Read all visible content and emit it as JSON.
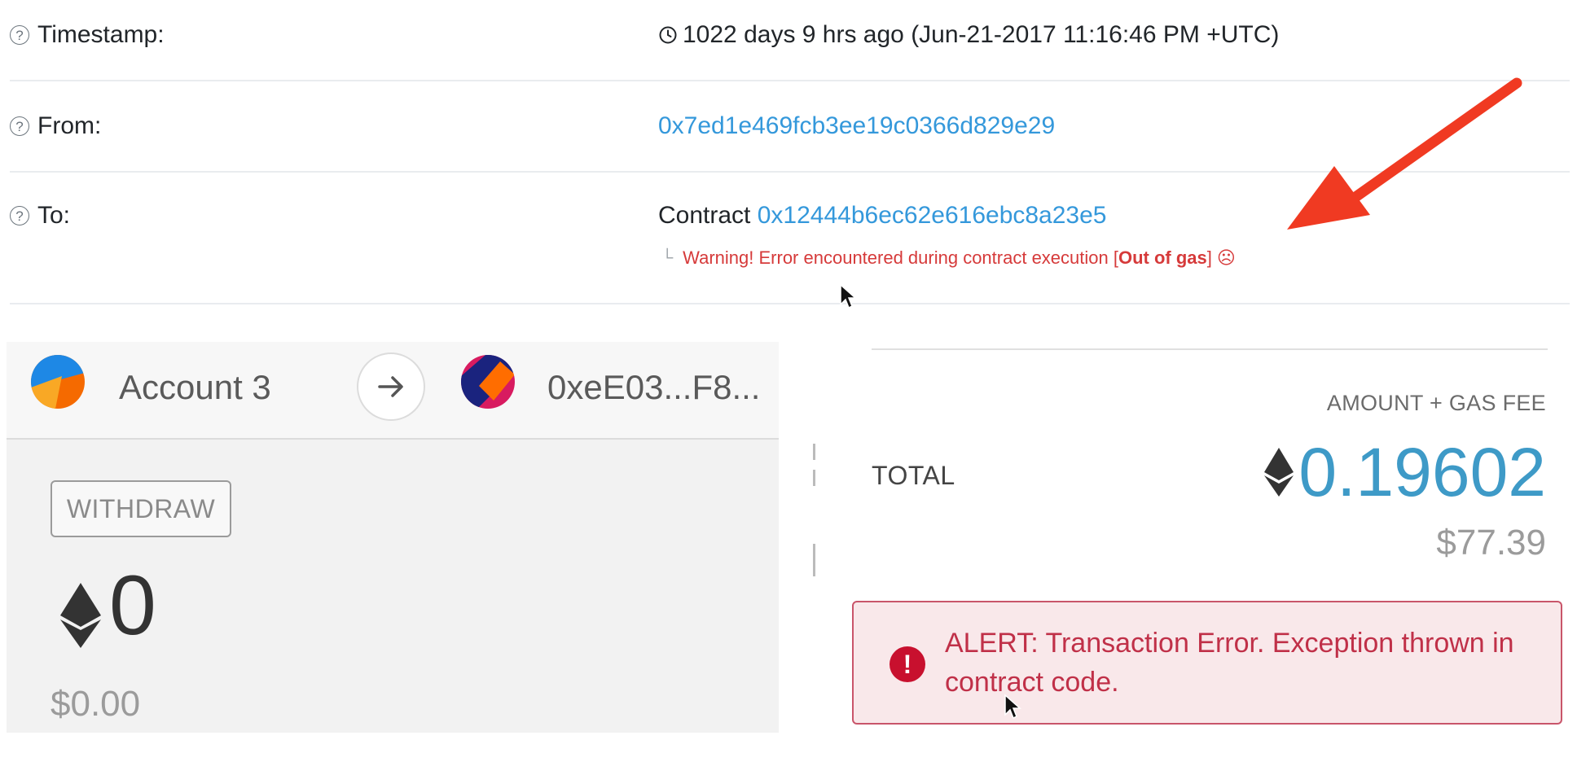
{
  "transaction": {
    "timestamp_label": "Timestamp:",
    "timestamp_value": "1022 days 9 hrs ago (Jun-21-2017 11:16:46 PM +UTC)",
    "from_label": "From:",
    "from_value": "0x7ed1e469fcb3ee19c0366d829e29",
    "to_label": "To:",
    "to_prefix": "Contract",
    "to_value": "0x12444b6ec62e616ebc8a23e5",
    "warning_prefix": "Warning! Error encountered during contract execution [",
    "warning_bold": "Out of gas",
    "warning_suffix": "]",
    "help_symbol": "?",
    "sad_symbol": "☹",
    "corner_symbol": "└"
  },
  "metamask": {
    "account_name": "Account 3",
    "recipient_short": "0xeE03...F8...",
    "withdraw_label": "WITHDRAW",
    "balance": "0",
    "balance_fiat": "$0.00",
    "amount_gas_label": "AMOUNT + GAS FEE",
    "total_label": "TOTAL",
    "total_eth": "0.19602",
    "total_fiat": "$77.39",
    "alert_symbol": "!",
    "alert_text": "ALERT: Transaction Error. Exception thrown in contract code."
  },
  "icons": {
    "help": "question-circle-icon",
    "clock": "clock-icon",
    "arrow": "red-annotation-arrow",
    "eth": "ethereum-icon",
    "alert": "alert-exclamation-icon"
  },
  "colors": {
    "link": "#3498db",
    "warning": "#d63a3a",
    "annotation_arrow": "#f03a22",
    "total": "#3e9ac7",
    "alert_bg": "#f9e8ea",
    "alert_text": "#c03048"
  }
}
